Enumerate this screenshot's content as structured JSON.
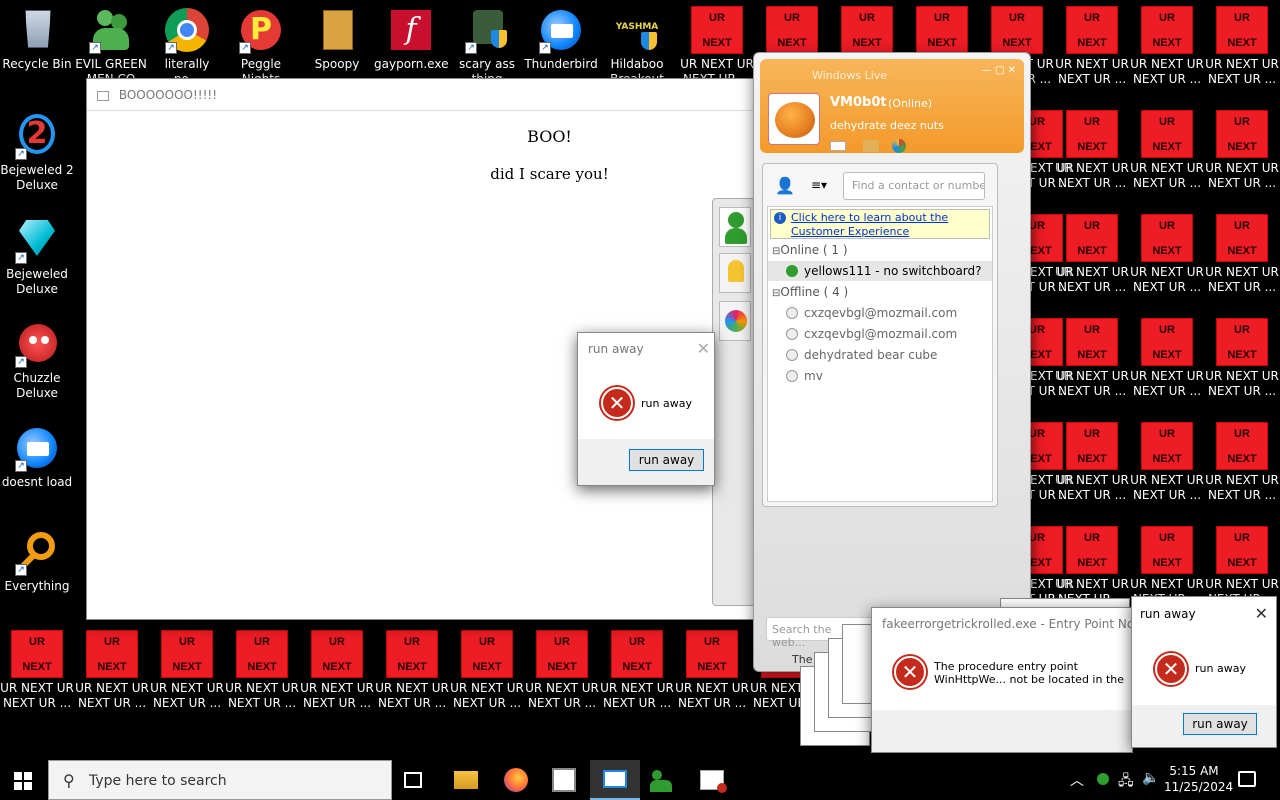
{
  "desktop_icons": [
    {
      "label": "Recycle Bin"
    },
    {
      "label": "EVIL GREEN MEN CO"
    },
    {
      "label": "literally no..."
    },
    {
      "label": "Peggle Nights"
    },
    {
      "label": "Spoopy"
    },
    {
      "label": "gayporn.exe"
    },
    {
      "label": "scary ass thing"
    },
    {
      "label": "Thunderbird"
    },
    {
      "label": "Hildaboo Breakout"
    },
    {
      "label": "Bejeweled 2 Deluxe"
    },
    {
      "label": "Bejeweled Deluxe"
    },
    {
      "label": "Chuzzle Deluxe"
    },
    {
      "label": "doesnt load"
    },
    {
      "label": "Everything"
    }
  ],
  "ur_icon": {
    "top": "UR",
    "bottom": "NEXT",
    "label1": "UR NEXT UR",
    "label2": "NEXT UR ..."
  },
  "boo_window": {
    "title": "BOOOOOOO!!!!!",
    "heading": "BOO!",
    "text": "did I scare you!"
  },
  "run_away_dialog": {
    "title": "run away",
    "message": "run away",
    "button": "run away"
  },
  "msn": {
    "app_title": "Windows Live",
    "username": "VM0b0t",
    "status": "(Online)",
    "personal_message": "dehydrate deez nuts",
    "search_placeholder": "Find a contact or numbe",
    "info_link": "Click here to learn about the Customer Experience",
    "online_header": "Online ( 1 )",
    "online_contacts": [
      "yellows111 - no switchboard?"
    ],
    "offline_header": "Offline ( 4 )",
    "offline_contacts": [
      "cxzqevbgl@mozmail.com",
      "cxzqevbgl@mozmail.com",
      "dehydrated bear cube",
      "mv"
    ],
    "web_search_placeholder": "Search the web...",
    "footer": "The Future of MS"
  },
  "entry_point_dialog": {
    "title": "fakeerrorgetrickrolled.exe - Entry Point Not Found",
    "message": "The procedure entry point WinHttpWe... not be located in the dynamic link libra..."
  },
  "taskbar": {
    "search_placeholder": "Type here to search",
    "time": "5:15 AM",
    "date": "11/25/2024"
  }
}
